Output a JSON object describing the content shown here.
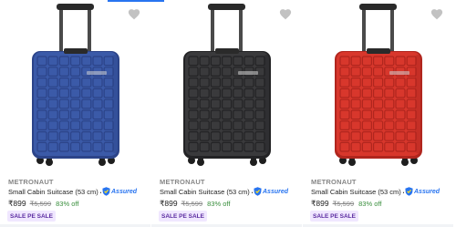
{
  "products": [
    {
      "brand": "METRONAUT",
      "title": "Small Cabin Suitcase (53 cm) 4 ...",
      "price": "₹899",
      "mrp": "₹5,599",
      "discount": "83% off",
      "assured_label": "Assured",
      "badge": "SALE PE SALE",
      "color": "blue",
      "body_color": "#3b5aa8",
      "body_shade": "#2c4489"
    },
    {
      "brand": "METRONAUT",
      "title": "Small Cabin Suitcase (53 cm) 4 ...",
      "price": "₹899",
      "mrp": "₹5,599",
      "discount": "83% off",
      "assured_label": "Assured",
      "badge": "SALE PE SALE",
      "color": "black",
      "body_color": "#3a3a3c",
      "body_shade": "#232325"
    },
    {
      "brand": "METRONAUT",
      "title": "Small Cabin Suitcase (53 cm) 4 ...",
      "price": "₹899",
      "mrp": "₹5,599",
      "discount": "83% off",
      "assured_label": "Assured",
      "badge": "SALE PE SALE",
      "color": "red",
      "body_color": "#d8372c",
      "body_shade": "#b0261e"
    }
  ],
  "icons": {
    "wishlist": "heart-icon",
    "assured": "assured-shield-icon"
  }
}
